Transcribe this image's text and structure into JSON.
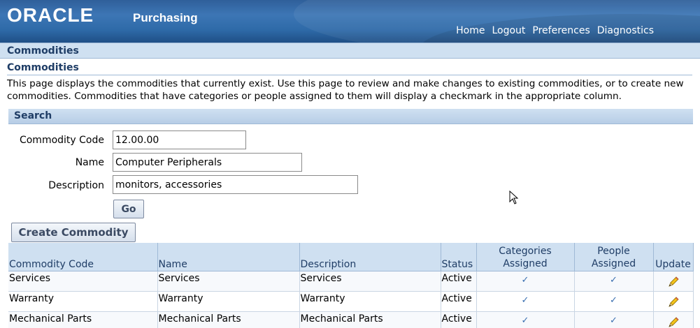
{
  "header": {
    "logo": "ORACLE",
    "app_name": "Purchasing",
    "links": [
      "Home",
      "Logout",
      "Preferences",
      "Diagnostics"
    ]
  },
  "breadcrumb": "Commodities",
  "page": {
    "title": "Commodities",
    "instructions": "This page displays the commodities that currently exist. Use this page to review and make changes to existing commodities, or to create new commodities. Commodities that have categories or people assigned to them will display a checkmark in the appropriate column."
  },
  "search": {
    "header": "Search",
    "fields": {
      "code_label": "Commodity Code",
      "code_value": "12.00.00",
      "name_label": "Name",
      "name_value": "Computer Peripherals",
      "desc_label": "Description",
      "desc_value": "monitors, accessories"
    },
    "go_label": "Go"
  },
  "create_label": "Create Commodity",
  "table": {
    "columns": [
      "Commodity Code",
      "Name",
      "Description",
      "Status",
      "Categories Assigned",
      "People Assigned",
      "Update"
    ],
    "rows": [
      {
        "code": "Services",
        "name": "Services",
        "description": "Services",
        "status": "Active"
      },
      {
        "code": "Warranty",
        "name": "Warranty",
        "description": "Warranty",
        "status": "Active"
      },
      {
        "code": "Mechanical Parts",
        "name": "Mechanical Parts",
        "description": "Mechanical Parts",
        "status": "Active"
      }
    ]
  },
  "colors": {
    "header_blue": "#3d76b5",
    "label_blue": "#1f3d66",
    "band_blue": "#cfe0f1",
    "check_blue": "#3a6fb0",
    "pencil_yellow": "#f2c21b"
  }
}
